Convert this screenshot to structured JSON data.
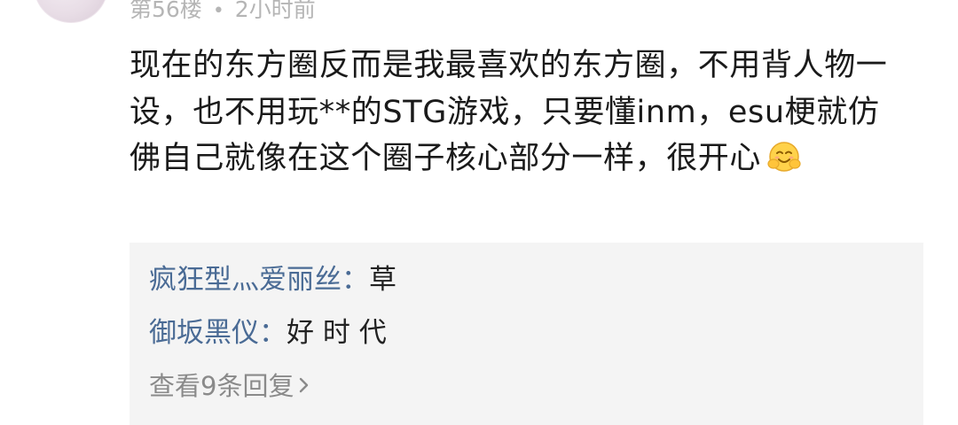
{
  "comment": {
    "floor": "第56楼",
    "separator": "•",
    "time": "2小时前",
    "text": "现在的东方圈反而是我最喜欢的东方圈，不用背人物一设，也不用玩**的STG游戏，只要懂inm，esu梗就仿佛自己就像在这个圈子核心部分一样，很开心"
  },
  "icons": {
    "emoji": "smiling-face-with-hands-icon",
    "chevron": "chevron-right-icon"
  },
  "replies": [
    {
      "user": "疯狂型灬爱丽丝：",
      "text": "草"
    },
    {
      "user": "御坂黑仪：",
      "text": "好 时 代"
    }
  ],
  "view_more": "查看9条回复",
  "colors": {
    "username": "#4a6b95",
    "meta": "#b5b5b5",
    "reply_bg": "#f4f4f4"
  }
}
